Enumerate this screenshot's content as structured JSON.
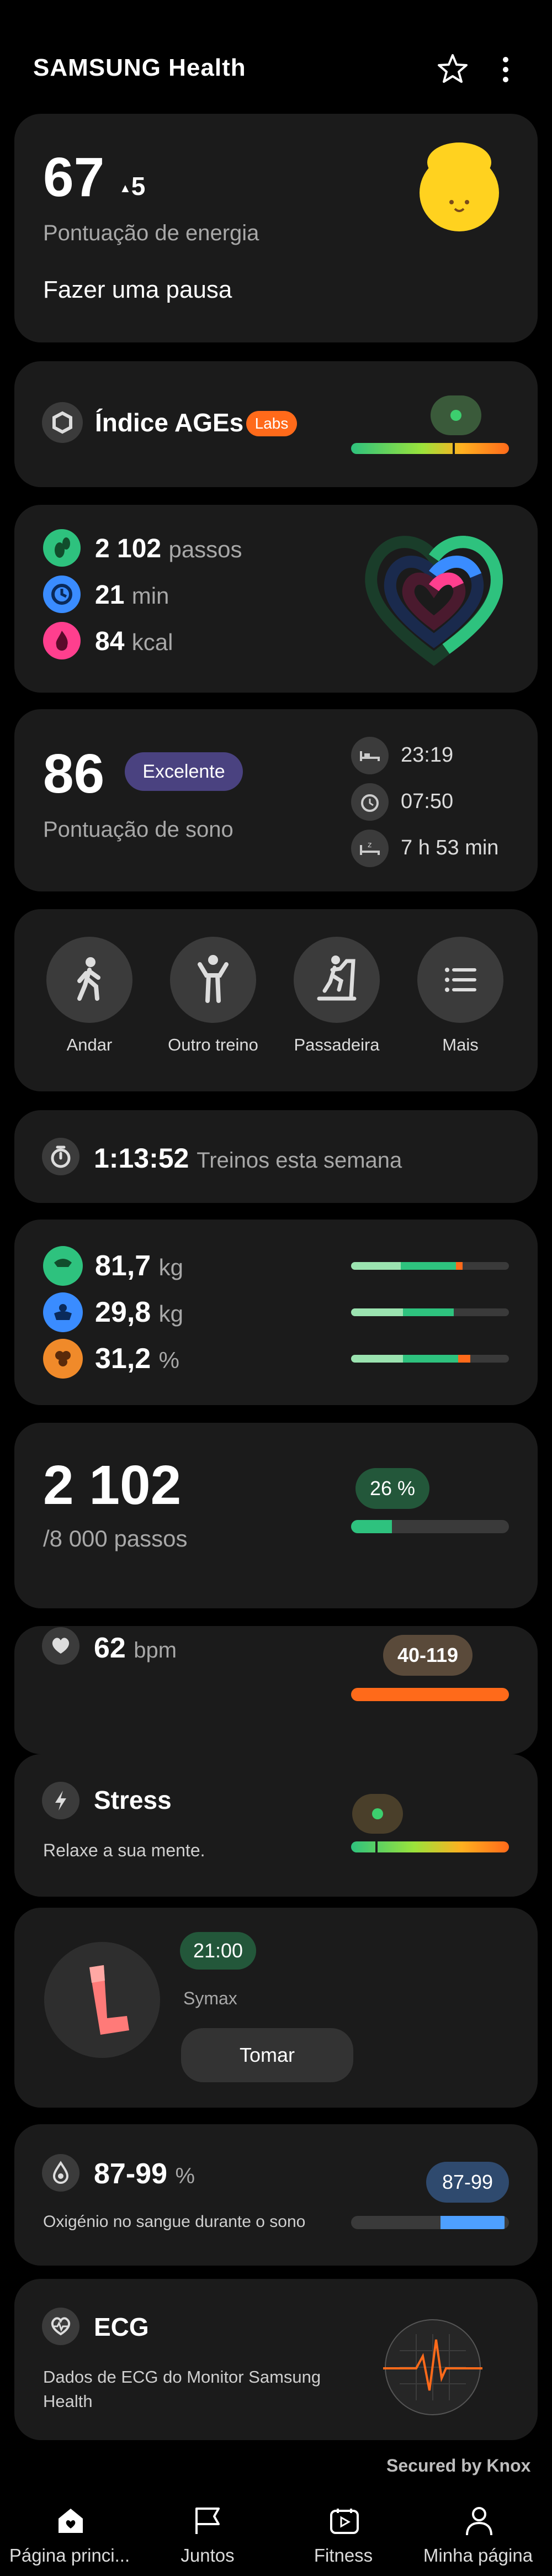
{
  "header": {
    "title": "SAMSUNG Health"
  },
  "energy": {
    "score": "67",
    "delta": "5",
    "label": "Pontuação de energia",
    "advice": "Fazer uma pausa"
  },
  "ages": {
    "title": "Índice AGEs",
    "badge": "Labs"
  },
  "activity": {
    "steps_value": "2 102",
    "steps_unit": "passos",
    "time_value": "21",
    "time_unit": "min",
    "cal_value": "84",
    "cal_unit": "kcal"
  },
  "sleep": {
    "score": "86",
    "badge": "Excelente",
    "label": "Pontuação de sono",
    "bedtime": "23:19",
    "wake": "07:50",
    "duration": "7 h 53 min"
  },
  "workouts": {
    "items": [
      {
        "label": "Andar",
        "icon": "walk-icon"
      },
      {
        "label": "Outro treino",
        "icon": "workout-icon"
      },
      {
        "label": "Passadeira",
        "icon": "treadmill-icon"
      },
      {
        "label": "Mais",
        "icon": "list-icon"
      }
    ]
  },
  "weekly": {
    "time": "1:13:52",
    "label": "Treinos esta semana"
  },
  "body": {
    "weight_value": "81,7",
    "weight_unit": "kg",
    "muscle_value": "29,8",
    "muscle_unit": "kg",
    "fat_value": "31,2",
    "fat_unit": "%"
  },
  "steps": {
    "value": "2 102",
    "goal": "/8 000 passos",
    "percent": "26 %",
    "progress": 0.26
  },
  "heart": {
    "value": "62",
    "unit": "bpm",
    "range": "40-119"
  },
  "stress": {
    "title": "Stress",
    "subtitle": "Relaxe a sua mente."
  },
  "medication": {
    "time": "21:00",
    "name": "Symax",
    "button": "Tomar"
  },
  "oxygen": {
    "value": "87-99",
    "unit": "%",
    "label": "Oxigénio no sangue durante o sono",
    "badge": "87-99"
  },
  "ecg": {
    "title": "ECG",
    "subtitle": "Dados de ECG do Monitor Samsung Health"
  },
  "footer": {
    "secured": "Secured by Knox"
  },
  "nav": {
    "items": [
      {
        "label": "Página princi...",
        "icon": "home-icon"
      },
      {
        "label": "Juntos",
        "icon": "flag-icon"
      },
      {
        "label": "Fitness",
        "icon": "fitness-play-icon"
      },
      {
        "label": "Minha página",
        "icon": "person-icon"
      }
    ]
  },
  "colors": {
    "accent_green": "#3ccf6e",
    "accent_orange": "#ff6a1a",
    "card": "#1b1b1b"
  }
}
